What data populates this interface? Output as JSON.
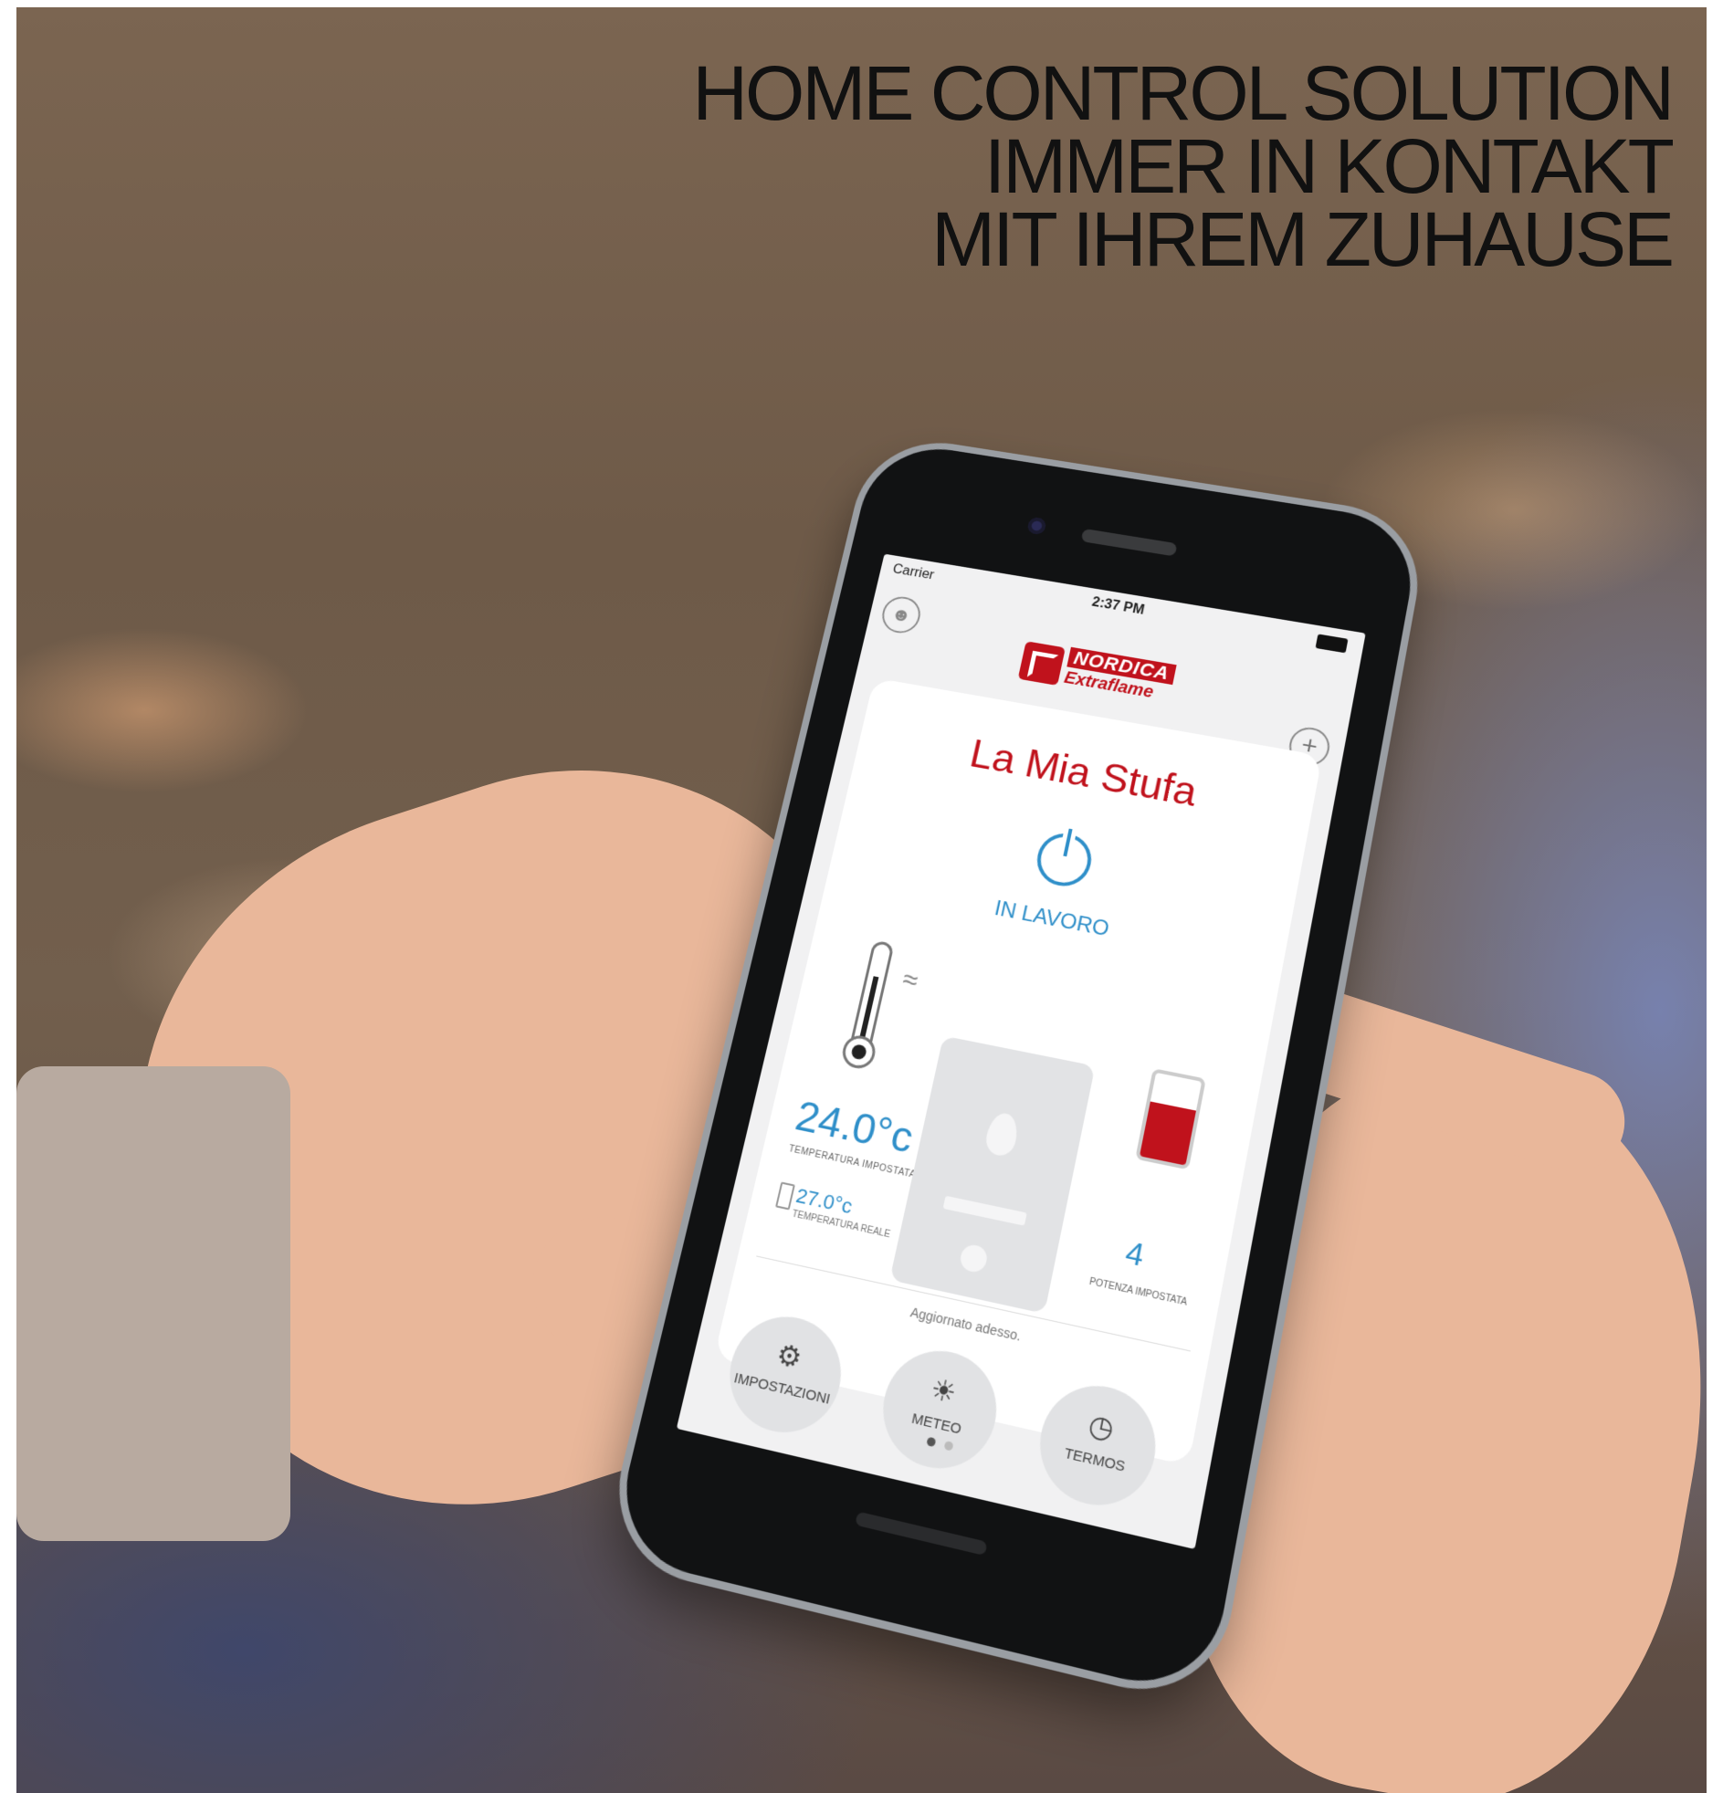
{
  "headline": {
    "line1": "HOME CONTROL SOLUTION",
    "line2": "IMMER IN KONTAKT",
    "line3": "MIT IHREM ZUHAUSE"
  },
  "app": {
    "status_bar": {
      "carrier": "Carrier",
      "time": "2:37 PM"
    },
    "brand": {
      "name": "NORDICA",
      "sub": "Extraflame",
      "color": "#c0121c"
    },
    "icons": {
      "user": "user-icon",
      "add": "plus-icon",
      "power": "power-icon"
    },
    "stove_name": "La Mia Stufa",
    "status": "IN LAVORO",
    "set_temperature": "24.0°c",
    "set_temperature_label": "TEMPERATURA IMPOSTATA",
    "real_temperature": "27.0°c",
    "real_temperature_label": "TEMPERATURA REALE",
    "power_level": "4",
    "power_label": "POTENZA IMPOSTATA",
    "power_fraction": 0.65,
    "updated": "Aggiornato adesso.",
    "buttons": {
      "settings": "IMPOSTAZIONI",
      "weather": "METEO",
      "thermostat": "TERMOS"
    },
    "accent_blue": "#2f8fc9",
    "page": {
      "current": 1,
      "total": 2
    }
  }
}
